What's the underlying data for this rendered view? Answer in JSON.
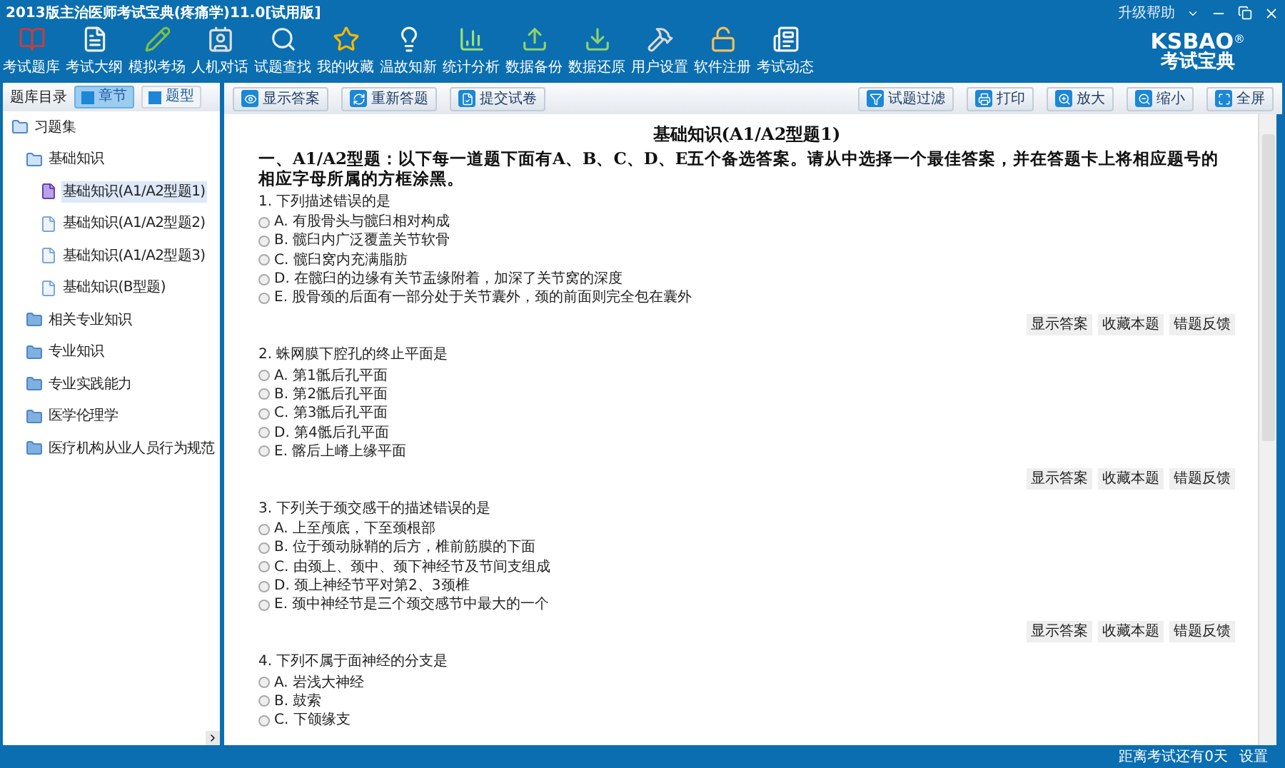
{
  "window": {
    "title": "2013版主治医师考试宝典(疼痛学)11.0[试用版]",
    "help_menu": "升级帮助"
  },
  "logo": {
    "brand": "KSBAO",
    "mark": "®",
    "subtitle": "考试宝典"
  },
  "toolbar": [
    "考试题库",
    "考试大纲",
    "模拟考场",
    "人机对话",
    "试题查找",
    "我的收藏",
    "温故知新",
    "统计分析",
    "数据备份",
    "数据还原",
    "用户设置",
    "软件注册",
    "考试动态"
  ],
  "sidebar": {
    "title": "题库目录",
    "tabs": [
      {
        "label": "章节",
        "selected": true
      },
      {
        "label": "题型",
        "selected": false
      }
    ],
    "tree": [
      {
        "label": "习题集",
        "expanded": true,
        "children": [
          {
            "label": "基础知识",
            "expanded": true,
            "children": [
              {
                "label": "基础知识(A1/A2型题1)",
                "selected": true
              },
              {
                "label": "基础知识(A1/A2型题2)",
                "selected": false
              },
              {
                "label": "基础知识(A1/A2型题3)",
                "selected": false
              },
              {
                "label": "基础知识(B型题)",
                "selected": false
              }
            ]
          },
          {
            "label": "相关专业知识",
            "expanded": false
          },
          {
            "label": "专业知识",
            "expanded": false
          },
          {
            "label": "专业实践能力",
            "expanded": false
          },
          {
            "label": "医学伦理学",
            "expanded": false
          },
          {
            "label": "医疗机构从业人员行为规范",
            "expanded": false
          }
        ]
      }
    ]
  },
  "content_toolbar": {
    "left": [
      "显示答案",
      "重新答题",
      "提交试卷"
    ],
    "right": [
      "试题过滤",
      "打印",
      "放大",
      "缩小",
      "全屏"
    ]
  },
  "paper": {
    "title": "基础知识(A1/A2型题1)",
    "instructions": "一、A1/A2型题：以下每一道题下面有A、B、C、D、E五个备选答案。请从中选择一个最佳答案，并在答题卡上将相应题号的相应字母所属的方框涂黑。",
    "questions": [
      {
        "stem": "1. 下列描述错误的是",
        "options": [
          {
            "text": "A. 有股骨头与髋臼相对构成",
            "selected": false
          },
          {
            "text": "B. 髋臼内广泛覆盖关节软骨",
            "selected": false
          },
          {
            "text": "C. 髋臼窝内充满脂肪",
            "selected": false
          },
          {
            "text": "D. 在髋臼的边缘有关节盂缘附着，加深了关节窝的深度",
            "selected": false
          },
          {
            "text": "E. 股骨颈的后面有一部分处于关节囊外，颈的前面则完全包在囊外",
            "selected": false
          }
        ],
        "actions": [
          "显示答案",
          "收藏本题",
          "错题反馈"
        ]
      },
      {
        "stem": "2. 蛛网膜下腔孔的终止平面是",
        "options": [
          {
            "text": "A. 第1骶后孔平面",
            "selected": false
          },
          {
            "text": "B. 第2骶后孔平面",
            "selected": false
          },
          {
            "text": "C. 第3骶后孔平面",
            "selected": false
          },
          {
            "text": "D. 第4骶后孔平面",
            "selected": false
          },
          {
            "text": "E. 髂后上嵴上缘平面",
            "selected": false
          }
        ],
        "actions": [
          "显示答案",
          "收藏本题",
          "错题反馈"
        ]
      },
      {
        "stem": "3. 下列关于颈交感干的描述错误的是",
        "options": [
          {
            "text": "A. 上至颅底，下至颈根部",
            "selected": false
          },
          {
            "text": "B. 位于颈动脉鞘的后方，椎前筋膜的下面",
            "selected": false
          },
          {
            "text": "C. 由颈上、颈中、颈下神经节及节间支组成",
            "selected": false
          },
          {
            "text": "D. 颈上神经节平对第2、3颈椎",
            "selected": false
          },
          {
            "text": "E. 颈中神经节是三个颈交感节中最大的一个",
            "selected": false
          }
        ],
        "actions": [
          "显示答案",
          "收藏本题",
          "错题反馈"
        ]
      },
      {
        "stem": "4. 下列不属于面神经的分支是",
        "options": [
          {
            "text": "A. 岩浅大神经",
            "selected": false
          },
          {
            "text": "B. 鼓索",
            "selected": false
          },
          {
            "text": "C. 下颌缘支",
            "selected": false
          }
        ]
      }
    ]
  },
  "status_bar": {
    "countdown": "距离考试还有0天",
    "settings": "设置"
  }
}
